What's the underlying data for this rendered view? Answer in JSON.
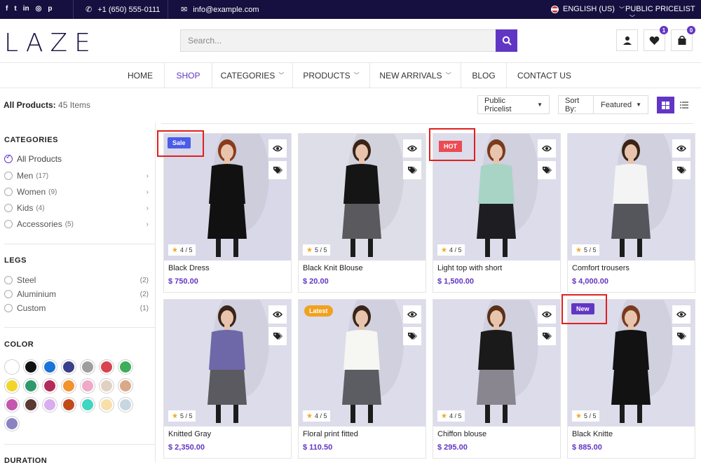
{
  "topbar": {
    "social_icons": [
      "facebook-icon",
      "twitter-icon",
      "linkedin-icon",
      "instagram-icon",
      "pinterest-icon"
    ],
    "social_glyphs": [
      "f",
      "t",
      "in",
      "◎",
      "p"
    ],
    "phone": "+1 (650) 555-0111",
    "email": "info@example.com",
    "language": "ENGLISH (US)",
    "pricelist": "PUBLIC PRICELIST"
  },
  "header": {
    "logo": "LAZE",
    "search_placeholder": "Search...",
    "wishlist_count": "1",
    "cart_count": "0"
  },
  "nav": {
    "items": [
      {
        "label": "HOME"
      },
      {
        "label": "SHOP"
      },
      {
        "label": "CATEGORIES"
      },
      {
        "label": "PRODUCTS"
      },
      {
        "label": "NEW ARRIVALS"
      },
      {
        "label": "BLOG"
      },
      {
        "label": "CONTACT US"
      }
    ]
  },
  "toolbar": {
    "all_products_label": "All Products:",
    "count": "45 Items",
    "pricelist": "Public Pricelist",
    "sort_label": "Sort By:",
    "sort_value": "Featured"
  },
  "sidebar": {
    "categories_title": "CATEGORIES",
    "categories": [
      {
        "label": "All Products",
        "count": ""
      },
      {
        "label": "Men",
        "count": "(17)"
      },
      {
        "label": "Women",
        "count": "(9)"
      },
      {
        "label": "Kids",
        "count": "(4)"
      },
      {
        "label": "Accessories",
        "count": "(5)"
      }
    ],
    "legs_title": "LEGS",
    "legs": [
      {
        "label": "Steel",
        "count": "(2)"
      },
      {
        "label": "Aluminium",
        "count": "(2)"
      },
      {
        "label": "Custom",
        "count": "(1)"
      }
    ],
    "color_title": "COLOR",
    "colors": [
      "#ffffff",
      "#111111",
      "#1a73d9",
      "#3a3f8a",
      "#9e9e9e",
      "#d9434f",
      "#3dae5a",
      "#f1d629",
      "#2e9a6c",
      "#b42a5a",
      "#f2922a",
      "#f0a9c8",
      "#e0d2c2",
      "#d9a98a",
      "#c456b0",
      "#5a3a33",
      "#d8aef0",
      "#c24a1a",
      "#3fd6c2",
      "#f7dfa8",
      "#c8d6e0",
      "#8a82c2"
    ],
    "duration_title": "DURATION"
  },
  "products": [
    {
      "name": "Black Dress",
      "price": "$ 750.00",
      "rating": "4 / 5",
      "badge": "Sale",
      "badge_color": "#4a5ce8",
      "bg": "#d8d8e8",
      "top": "#111111",
      "bottom": "#111111",
      "hair": "#8a3b1c"
    },
    {
      "name": "Black Knit Blouse",
      "price": "$ 20.00",
      "rating": "5 / 5",
      "badge": "",
      "badge_color": "",
      "bg": "#dedee8",
      "top": "#151515",
      "bottom": "#5a5a5e",
      "hair": "#3a2418"
    },
    {
      "name": "Light top with short",
      "price": "$ 1,500.00",
      "rating": "4 / 5",
      "badge": "HOT",
      "badge_color": "#ec4b53",
      "bg": "#dcdcea",
      "top": "#a8d4c6",
      "bottom": "#1e1e22",
      "hair": "#7a3a1c"
    },
    {
      "name": "Comfort trousers",
      "price": "$ 4,000.00",
      "rating": "5 / 5",
      "badge": "",
      "badge_color": "",
      "bg": "#dcdcea",
      "top": "#f4f4f4",
      "bottom": "#55565c",
      "hair": "#3a2418"
    },
    {
      "name": "Knitted Gray",
      "price": "$ 2,350.00",
      "rating": "5 / 5",
      "badge": "",
      "badge_color": "",
      "bg": "#dcdcea",
      "top": "#6e68a8",
      "bottom": "#5a5a60",
      "hair": "#3a2418"
    },
    {
      "name": "Floral print fitted",
      "price": "$ 110.50",
      "rating": "4 / 5",
      "badge": "Latest",
      "badge_color": "#f0a21e",
      "bg": "#dcdcea",
      "top": "#f6f6f2",
      "bottom": "#5c5d62",
      "hair": "#3a2418"
    },
    {
      "name": "Chiffon blouse",
      "price": "$ 295.00",
      "rating": "4 / 5",
      "badge": "",
      "badge_color": "",
      "bg": "#dcdcea",
      "top": "#1a1a1a",
      "bottom": "#8a8690",
      "hair": "#5a3018"
    },
    {
      "name": "Black Knitte",
      "price": "$ 885.00",
      "rating": "5 / 5",
      "badge": "New",
      "badge_color": "#6236c4",
      "bg": "#dcdcea",
      "top": "#121212",
      "bottom": "#121212",
      "hair": "#7a3a1c"
    }
  ],
  "accent_color": "#6236c4",
  "topbar_color": "#161040"
}
